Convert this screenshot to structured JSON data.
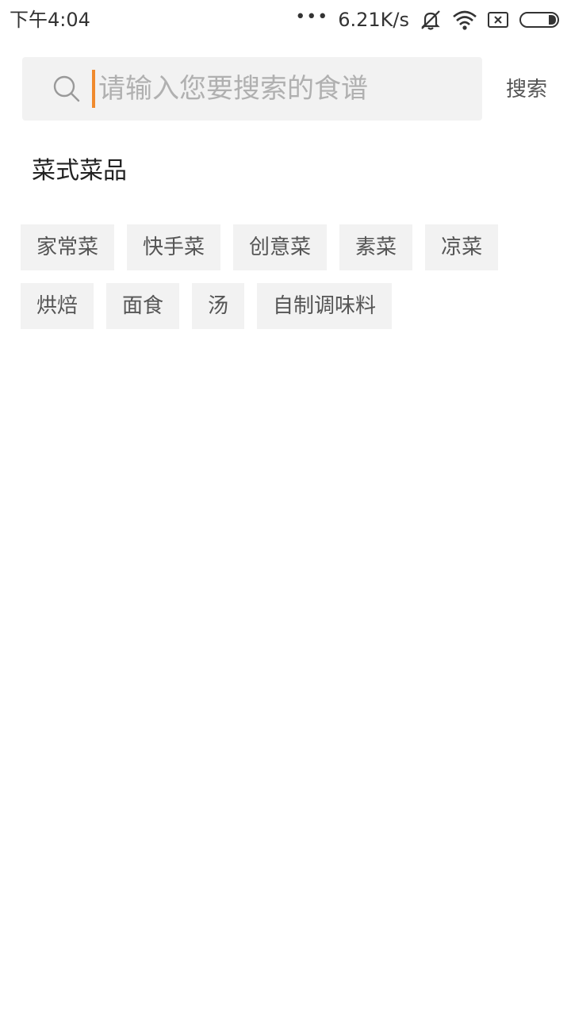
{
  "status_bar": {
    "time": "下午4:04",
    "dots": "•••",
    "network_speed": "6.21K/s",
    "icons": [
      "mute-bell-icon",
      "wifi-icon",
      "sim-x-icon",
      "battery-icon"
    ]
  },
  "search": {
    "placeholder": "请输入您要搜索的食谱",
    "value": "",
    "button_label": "搜索",
    "caret_color": "#f08a2e"
  },
  "section": {
    "title": "菜式菜品"
  },
  "tags": [
    {
      "label": "家常菜"
    },
    {
      "label": "快手菜"
    },
    {
      "label": "创意菜"
    },
    {
      "label": "素菜"
    },
    {
      "label": "凉菜"
    },
    {
      "label": "烘焙"
    },
    {
      "label": "面食"
    },
    {
      "label": "汤"
    },
    {
      "label": "自制调味料"
    }
  ]
}
